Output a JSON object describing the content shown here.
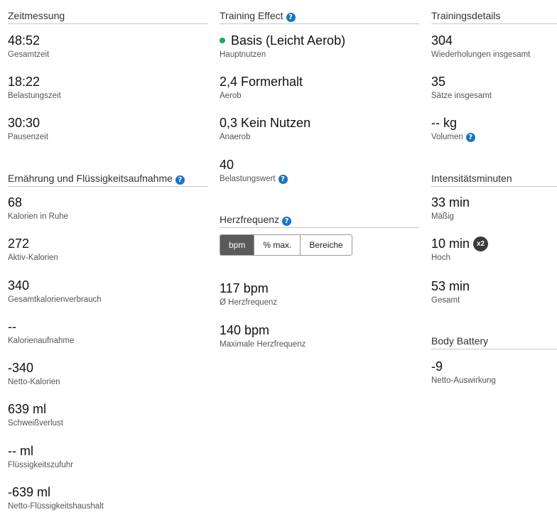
{
  "zeitmessung": {
    "title": "Zeitmessung",
    "stats": [
      {
        "value": "48:52",
        "label": "Gesamtzeit"
      },
      {
        "value": "18:22",
        "label": "Belastungszeit"
      },
      {
        "value": "30:30",
        "label": "Pausenzeit"
      }
    ]
  },
  "ernaehrung": {
    "title": "Ernährung und Flüssigkeitsaufnahme",
    "stats": [
      {
        "value": "68",
        "label": "Kalorien in Ruhe"
      },
      {
        "value": "272",
        "label": "Aktiv-Kalorien"
      },
      {
        "value": "340",
        "label": "Gesamtkalorienverbrauch"
      },
      {
        "value": "--",
        "label": "Kalorienaufnahme"
      },
      {
        "value": "-340",
        "label": "Netto-Kalorien"
      },
      {
        "value": "639 ml",
        "label": "Schweißverlust"
      },
      {
        "value": "-- ml",
        "label": "Flüssigkeitszufuhr"
      },
      {
        "value": "-639 ml",
        "label": "Netto-Flüssigkeitshaushalt"
      }
    ]
  },
  "training_effect": {
    "title": "Training Effect",
    "primary": {
      "value": "Basis (Leicht Aerob)",
      "label": "Hauptnutzen",
      "dot_color": "#1aaa5f"
    },
    "aerob": {
      "value": "2,4 Formerhalt",
      "label": "Aerob"
    },
    "anaerob": {
      "value": "0,3 Kein Nutzen",
      "label": "Anaerob"
    },
    "load": {
      "value": "40",
      "label": "Belastungswert"
    }
  },
  "herzfrequenz": {
    "title": "Herzfrequenz",
    "tabs": [
      "bpm",
      "% max.",
      "Bereiche"
    ],
    "active_tab": "bpm",
    "avg": {
      "value": "117 bpm",
      "label": "Ø Herzfrequenz"
    },
    "max": {
      "value": "140 bpm",
      "label": "Maximale Herzfrequenz"
    }
  },
  "trainingsdetails": {
    "title": "Trainingsdetails",
    "reps": {
      "value": "304",
      "label": "Wiederholungen insgesamt"
    },
    "sets": {
      "value": "35",
      "label": "Sätze insgesamt"
    },
    "volume": {
      "value": "-- kg",
      "label": "Volumen"
    }
  },
  "intensitaet": {
    "title": "Intensitätsminuten",
    "moderate": {
      "value": "33 min",
      "label": "Mäßig"
    },
    "high": {
      "value": "10 min",
      "label": "Hoch",
      "badge": "x2"
    },
    "total": {
      "value": "53 min",
      "label": "Gesamt"
    }
  },
  "body_battery": {
    "title": "Body Battery",
    "net": {
      "value": "-9",
      "label": "Netto-Auswirkung"
    }
  },
  "help_icon": "?",
  "colors": {
    "help": "#1a73c9",
    "active_tab": "#5a5a5a",
    "positive_dot": "#1aaa5f"
  }
}
